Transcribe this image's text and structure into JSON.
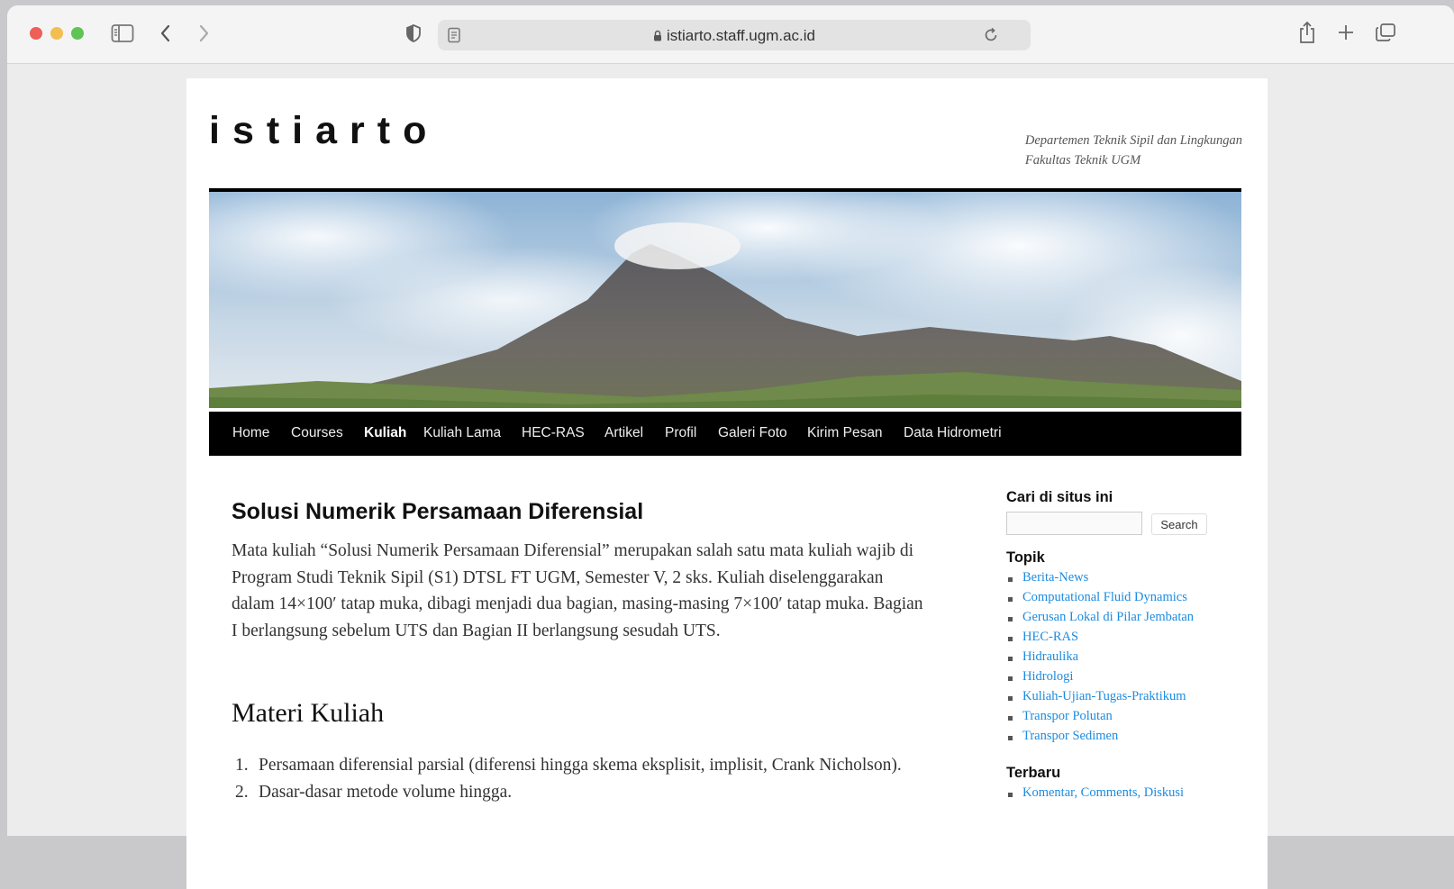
{
  "browser": {
    "url": "istiarto.staff.ugm.ac.id"
  },
  "site": {
    "title": "istiarto",
    "description_line1": "Departemen Teknik Sipil dan Lingkungan",
    "description_line2": "Fakultas Teknik UGM"
  },
  "nav": {
    "items": [
      "Home",
      "Courses",
      "Kuliah",
      "Kuliah Lama",
      "HEC-RAS",
      "Artikel",
      "Profil",
      "Galeri Foto",
      "Kirim Pesan",
      "Data Hidrometri"
    ],
    "active": "Kuliah"
  },
  "entry": {
    "title": "Solusi Numerik Persamaan Diferensial",
    "paragraph": "Mata kuliah “Solusi Numerik Persamaan Diferensial” merupakan salah satu mata kuliah wajib di Program Studi Teknik Sipil (S1) DTSL FT UGM, Semester V, 2 sks. Kuliah diselenggarakan dalam 14×100′ tatap muka, dibagi menjadi dua bagian, masing-masing 7×100′ tatap muka. Bagian I berlangsung sebelum UTS dan Bagian II berlangsung sesudah UTS.",
    "heading": "Materi Kuliah",
    "list": [
      {
        "num": "1.",
        "text": "Persamaan diferensial parsial (diferensi hingga skema eksplisit, implisit, Crank Nicholson)."
      },
      {
        "num": "2.",
        "text": "Dasar-dasar metode volume hingga."
      }
    ]
  },
  "sidebar": {
    "search_title": "Cari di situs ini",
    "search_button": "Search",
    "search_value": "",
    "topik_title": "Topik",
    "topik": [
      "Berita-News",
      "Computational Fluid Dynamics",
      "Gerusan Lokal di Pilar Jembatan",
      "HEC-RAS",
      "Hidraulika",
      "Hidrologi",
      "Kuliah-Ujian-Tugas-Praktikum",
      "Transpor Polutan",
      "Transpor Sedimen"
    ],
    "terbaru_title": "Terbaru",
    "terbaru": [
      "Komentar, Comments, Diskusi"
    ]
  },
  "colors": {
    "link": "#1b8be0",
    "nav_bg": "#000000"
  }
}
